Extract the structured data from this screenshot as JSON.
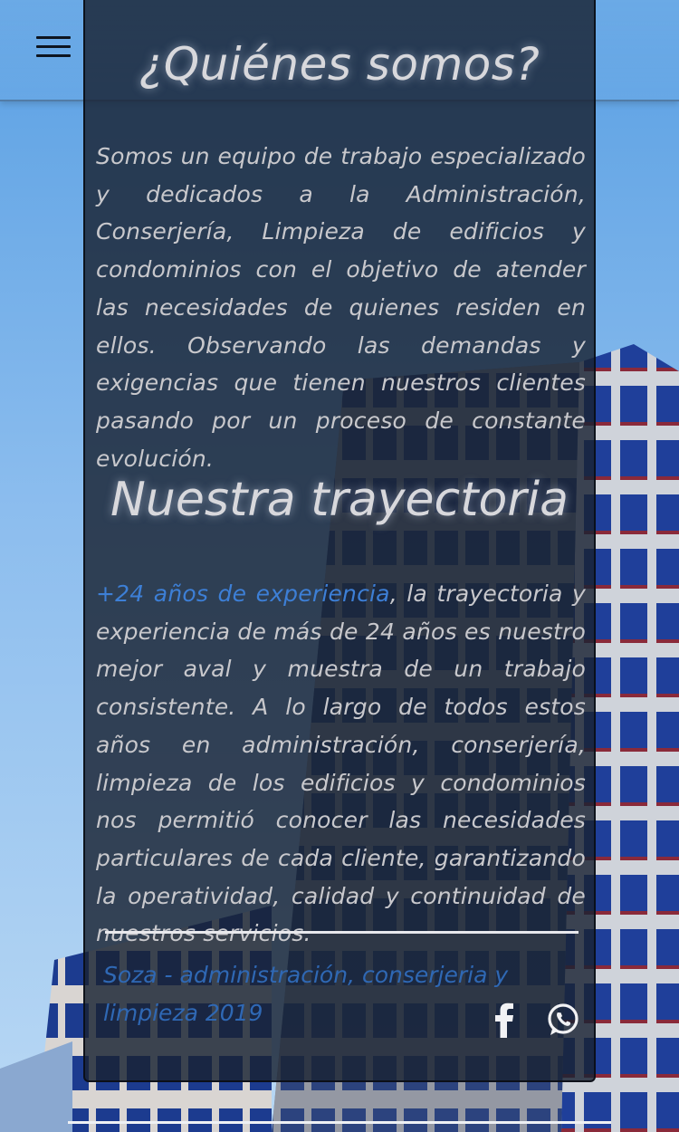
{
  "about": {
    "title": "¿Quiénes somos?",
    "text": "Somos un equipo de trabajo especializado y dedicados a la Administración, Conserjería, Limpieza de edificios y condominios con el objetivo de atender las necesidades de quienes residen en ellos. Observando las demandas y exigencias que tienen nuestros clientes pasando por un proceso de constante evolución."
  },
  "history": {
    "title": "Nuestra trayectoria",
    "highlight": "+24 años de experiencia",
    "text": ", la trayectoria y experiencia de más de 24 años es nuestro mejor aval y muestra de un trabajo consistente. A lo largo de todos estos años en administración, conserjería, limpieza de los edificios y condominios nos permitió conocer las necesidades particulares de cada cliente, garantizando la operatividad, calidad y continuidad de nuestros servicios."
  },
  "footer": {
    "text": "Soza - administración, conserjeria y limpieza 2019"
  },
  "icons": {
    "menu": "menu-icon",
    "facebook": "facebook-icon",
    "whatsapp": "whatsapp-icon"
  },
  "colors": {
    "accent": "#3d7fd6",
    "panel": "#192232",
    "text": "#c8c8cc"
  }
}
